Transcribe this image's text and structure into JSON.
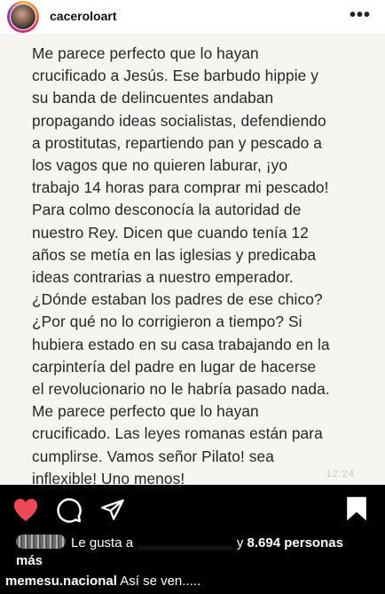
{
  "header": {
    "username": "caceroloart",
    "more_icon": "more-options-icon",
    "more_glyph": "•••"
  },
  "post": {
    "lines": [
      "Me parece perfecto que lo hayan",
      "crucificado a Jesús. Ese barbudo hippie y",
      "su banda de delincuentes andaban",
      "propagando ideas socialistas, defendiendo",
      "a prostitutas, repartiendo pan y pescado a",
      "los vagos que no quieren laburar, ¡yo",
      "trabajo 14 horas para comprar mi pescado!",
      "Para colmo desconocía la autoridad de",
      "nuestro Rey. Dicen que cuando tenía 12",
      "años se metía en las iglesias y predicaba",
      "ideas contrarias a nuestro emperador.",
      "¿Dónde estaban los padres de ese chico?",
      "¿Por qué no lo corrigieron a tiempo? Si",
      "hubiera estado en su casa trabajando en la",
      "carpintería del padre en lugar de hacerse",
      "el revolucionario no le habría pasado nada.",
      "Me parece perfecto que lo hayan",
      "crucificado. Las leyes romanas están para",
      "cumplirse. Vamos señor Pilato! sea",
      "inflexible! Uno menos!"
    ],
    "time": "12:24"
  },
  "actions": {
    "like_icon": "heart-icon",
    "comment_icon": "comment-icon",
    "share_icon": "share-icon",
    "save_icon": "bookmark-icon",
    "liked": true,
    "like_color": "#ed4956"
  },
  "likes": {
    "prefix": "Le gusta a",
    "liker": "_____________",
    "middle": "y",
    "count": "8.694 personas",
    "suffix": "más"
  },
  "caption": {
    "username": "memesu.nacional",
    "text": "Así se ven....."
  }
}
